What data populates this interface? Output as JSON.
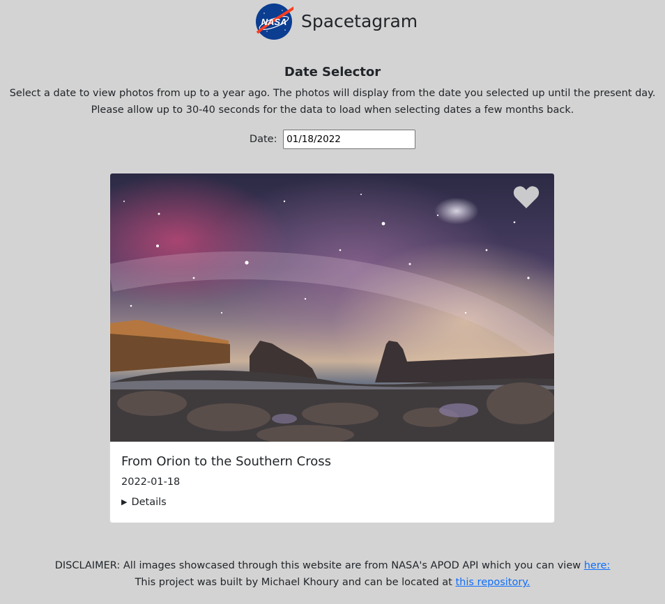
{
  "header": {
    "logo_text": "NASA",
    "app_title": "Spacetagram"
  },
  "date_selector": {
    "title": "Date Selector",
    "description_line1": "Select a date to view photos from up to a year ago. The photos will display from the date you selected up until the present day.",
    "description_line2": "Please allow up to 30-40 seconds for the data to load when selecting dates a few months back.",
    "date_label": "Date:",
    "date_value": "01/18/2022"
  },
  "card": {
    "title": "From Orion to the Southern Cross",
    "date": "2022-01-18",
    "details_label": "Details",
    "like_icon": "heart-icon",
    "liked": false
  },
  "footer": {
    "line1_text": "DISCLAIMER: All images showcased through this website are from NASA's APOD API which you can view",
    "line1_link": "here:",
    "line2_text": "This project was built by Michael Khoury and can be located at",
    "line2_link": "this repository."
  },
  "colors": {
    "background": "#d3d3d3",
    "link": "#0d6efd",
    "nasa_blue": "#0b3d91",
    "nasa_red": "#fc3d21"
  }
}
